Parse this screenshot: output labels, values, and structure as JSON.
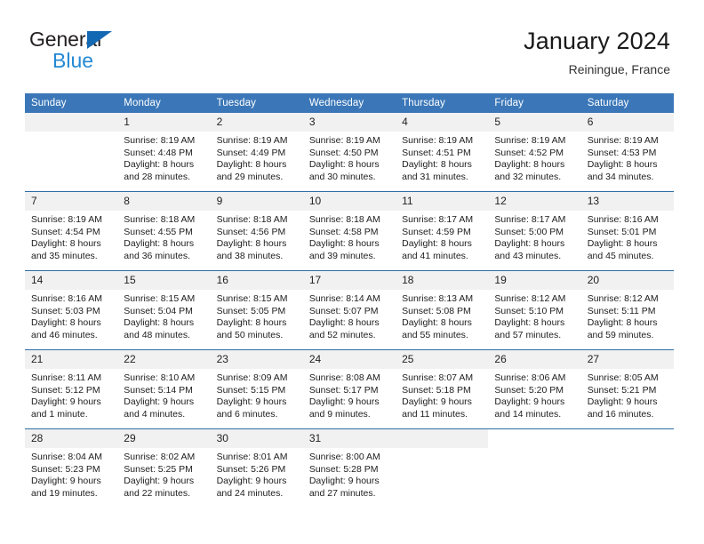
{
  "brand": {
    "name_part1": "General",
    "name_part2": "Blue",
    "triangle_color": "#1368b3",
    "blue_color": "#2489d4"
  },
  "header": {
    "title": "January 2024",
    "subtitle": "Reiningue, France"
  },
  "theme": {
    "header_bg": "#3b77b8",
    "header_text": "#ffffff",
    "row_divider": "#2e6da4",
    "daynum_bg": "#f1f1f1"
  },
  "calendar": {
    "weekday_headers": [
      "Sunday",
      "Monday",
      "Tuesday",
      "Wednesday",
      "Thursday",
      "Friday",
      "Saturday"
    ],
    "weeks": [
      [
        {
          "day": "",
          "sunrise": "",
          "sunset": "",
          "daylight1": "",
          "daylight2": "",
          "blank": false
        },
        {
          "day": "1",
          "sunrise": "Sunrise: 8:19 AM",
          "sunset": "Sunset: 4:48 PM",
          "daylight1": "Daylight: 8 hours",
          "daylight2": "and 28 minutes."
        },
        {
          "day": "2",
          "sunrise": "Sunrise: 8:19 AM",
          "sunset": "Sunset: 4:49 PM",
          "daylight1": "Daylight: 8 hours",
          "daylight2": "and 29 minutes."
        },
        {
          "day": "3",
          "sunrise": "Sunrise: 8:19 AM",
          "sunset": "Sunset: 4:50 PM",
          "daylight1": "Daylight: 8 hours",
          "daylight2": "and 30 minutes."
        },
        {
          "day": "4",
          "sunrise": "Sunrise: 8:19 AM",
          "sunset": "Sunset: 4:51 PM",
          "daylight1": "Daylight: 8 hours",
          "daylight2": "and 31 minutes."
        },
        {
          "day": "5",
          "sunrise": "Sunrise: 8:19 AM",
          "sunset": "Sunset: 4:52 PM",
          "daylight1": "Daylight: 8 hours",
          "daylight2": "and 32 minutes."
        },
        {
          "day": "6",
          "sunrise": "Sunrise: 8:19 AM",
          "sunset": "Sunset: 4:53 PM",
          "daylight1": "Daylight: 8 hours",
          "daylight2": "and 34 minutes."
        }
      ],
      [
        {
          "day": "7",
          "sunrise": "Sunrise: 8:19 AM",
          "sunset": "Sunset: 4:54 PM",
          "daylight1": "Daylight: 8 hours",
          "daylight2": "and 35 minutes."
        },
        {
          "day": "8",
          "sunrise": "Sunrise: 8:18 AM",
          "sunset": "Sunset: 4:55 PM",
          "daylight1": "Daylight: 8 hours",
          "daylight2": "and 36 minutes."
        },
        {
          "day": "9",
          "sunrise": "Sunrise: 8:18 AM",
          "sunset": "Sunset: 4:56 PM",
          "daylight1": "Daylight: 8 hours",
          "daylight2": "and 38 minutes."
        },
        {
          "day": "10",
          "sunrise": "Sunrise: 8:18 AM",
          "sunset": "Sunset: 4:58 PM",
          "daylight1": "Daylight: 8 hours",
          "daylight2": "and 39 minutes."
        },
        {
          "day": "11",
          "sunrise": "Sunrise: 8:17 AM",
          "sunset": "Sunset: 4:59 PM",
          "daylight1": "Daylight: 8 hours",
          "daylight2": "and 41 minutes."
        },
        {
          "day": "12",
          "sunrise": "Sunrise: 8:17 AM",
          "sunset": "Sunset: 5:00 PM",
          "daylight1": "Daylight: 8 hours",
          "daylight2": "and 43 minutes."
        },
        {
          "day": "13",
          "sunrise": "Sunrise: 8:16 AM",
          "sunset": "Sunset: 5:01 PM",
          "daylight1": "Daylight: 8 hours",
          "daylight2": "and 45 minutes."
        }
      ],
      [
        {
          "day": "14",
          "sunrise": "Sunrise: 8:16 AM",
          "sunset": "Sunset: 5:03 PM",
          "daylight1": "Daylight: 8 hours",
          "daylight2": "and 46 minutes."
        },
        {
          "day": "15",
          "sunrise": "Sunrise: 8:15 AM",
          "sunset": "Sunset: 5:04 PM",
          "daylight1": "Daylight: 8 hours",
          "daylight2": "and 48 minutes."
        },
        {
          "day": "16",
          "sunrise": "Sunrise: 8:15 AM",
          "sunset": "Sunset: 5:05 PM",
          "daylight1": "Daylight: 8 hours",
          "daylight2": "and 50 minutes."
        },
        {
          "day": "17",
          "sunrise": "Sunrise: 8:14 AM",
          "sunset": "Sunset: 5:07 PM",
          "daylight1": "Daylight: 8 hours",
          "daylight2": "and 52 minutes."
        },
        {
          "day": "18",
          "sunrise": "Sunrise: 8:13 AM",
          "sunset": "Sunset: 5:08 PM",
          "daylight1": "Daylight: 8 hours",
          "daylight2": "and 55 minutes."
        },
        {
          "day": "19",
          "sunrise": "Sunrise: 8:12 AM",
          "sunset": "Sunset: 5:10 PM",
          "daylight1": "Daylight: 8 hours",
          "daylight2": "and 57 minutes."
        },
        {
          "day": "20",
          "sunrise": "Sunrise: 8:12 AM",
          "sunset": "Sunset: 5:11 PM",
          "daylight1": "Daylight: 8 hours",
          "daylight2": "and 59 minutes."
        }
      ],
      [
        {
          "day": "21",
          "sunrise": "Sunrise: 8:11 AM",
          "sunset": "Sunset: 5:12 PM",
          "daylight1": "Daylight: 9 hours",
          "daylight2": "and 1 minute."
        },
        {
          "day": "22",
          "sunrise": "Sunrise: 8:10 AM",
          "sunset": "Sunset: 5:14 PM",
          "daylight1": "Daylight: 9 hours",
          "daylight2": "and 4 minutes."
        },
        {
          "day": "23",
          "sunrise": "Sunrise: 8:09 AM",
          "sunset": "Sunset: 5:15 PM",
          "daylight1": "Daylight: 9 hours",
          "daylight2": "and 6 minutes."
        },
        {
          "day": "24",
          "sunrise": "Sunrise: 8:08 AM",
          "sunset": "Sunset: 5:17 PM",
          "daylight1": "Daylight: 9 hours",
          "daylight2": "and 9 minutes."
        },
        {
          "day": "25",
          "sunrise": "Sunrise: 8:07 AM",
          "sunset": "Sunset: 5:18 PM",
          "daylight1": "Daylight: 9 hours",
          "daylight2": "and 11 minutes."
        },
        {
          "day": "26",
          "sunrise": "Sunrise: 8:06 AM",
          "sunset": "Sunset: 5:20 PM",
          "daylight1": "Daylight: 9 hours",
          "daylight2": "and 14 minutes."
        },
        {
          "day": "27",
          "sunrise": "Sunrise: 8:05 AM",
          "sunset": "Sunset: 5:21 PM",
          "daylight1": "Daylight: 9 hours",
          "daylight2": "and 16 minutes."
        }
      ],
      [
        {
          "day": "28",
          "sunrise": "Sunrise: 8:04 AM",
          "sunset": "Sunset: 5:23 PM",
          "daylight1": "Daylight: 9 hours",
          "daylight2": "and 19 minutes."
        },
        {
          "day": "29",
          "sunrise": "Sunrise: 8:02 AM",
          "sunset": "Sunset: 5:25 PM",
          "daylight1": "Daylight: 9 hours",
          "daylight2": "and 22 minutes."
        },
        {
          "day": "30",
          "sunrise": "Sunrise: 8:01 AM",
          "sunset": "Sunset: 5:26 PM",
          "daylight1": "Daylight: 9 hours",
          "daylight2": "and 24 minutes."
        },
        {
          "day": "31",
          "sunrise": "Sunrise: 8:00 AM",
          "sunset": "Sunset: 5:28 PM",
          "daylight1": "Daylight: 9 hours",
          "daylight2": "and 27 minutes."
        },
        {
          "day": "",
          "sunrise": "",
          "sunset": "",
          "daylight1": "",
          "daylight2": "",
          "blank": false
        },
        {
          "day": "",
          "sunrise": "",
          "sunset": "",
          "daylight1": "",
          "daylight2": "",
          "blank": true
        },
        {
          "day": "",
          "sunrise": "",
          "sunset": "",
          "daylight1": "",
          "daylight2": "",
          "blank": true
        }
      ]
    ]
  }
}
